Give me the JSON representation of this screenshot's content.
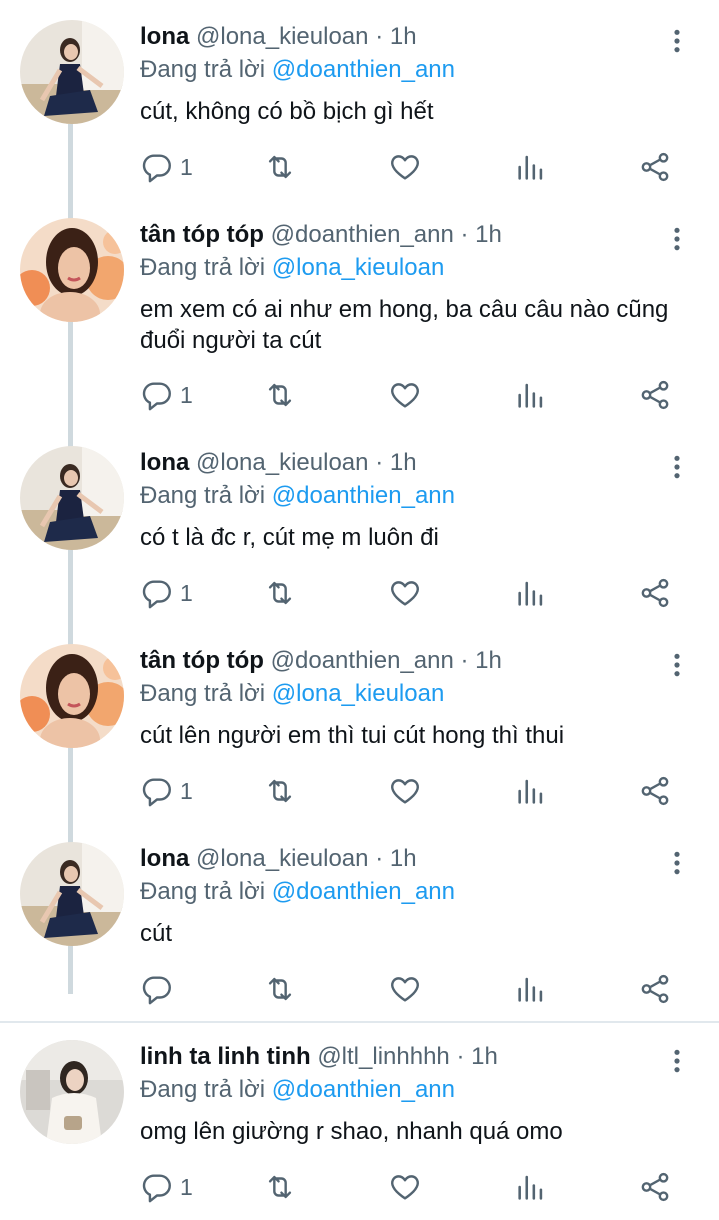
{
  "reply_prefix": "Đang trả lời",
  "tweets": [
    {
      "name": "lona",
      "handle": "@lona_kieuloan",
      "time": "· 1h",
      "reply_to": "@doanthien_ann",
      "text": "cút, không có bồ bịch gì hết",
      "reply_count": "1",
      "avatar": "lona-avatar"
    },
    {
      "name": "tân tóp tóp",
      "handle": "@doanthien_ann",
      "time": "· 1h",
      "reply_to": "@lona_kieuloan",
      "text": "em xem có ai như em hong, ba câu câu nào cũng đuổi người ta cút",
      "reply_count": "1",
      "avatar": "tan-avatar"
    },
    {
      "name": "lona",
      "handle": "@lona_kieuloan",
      "time": "· 1h",
      "reply_to": "@doanthien_ann",
      "text": "có t là đc r, cút mẹ m luôn đi",
      "reply_count": "1",
      "avatar": "lona-avatar"
    },
    {
      "name": "tân tóp tóp",
      "handle": "@doanthien_ann",
      "time": "· 1h",
      "reply_to": "@lona_kieuloan",
      "text": "cút lên người em thì tui cút hong thì thui",
      "reply_count": "1",
      "avatar": "tan-avatar"
    },
    {
      "name": "lona",
      "handle": "@lona_kieuloan",
      "time": "· 1h",
      "reply_to": "@doanthien_ann",
      "text": "cút",
      "reply_count": "",
      "avatar": "lona-avatar"
    },
    {
      "name": "linh ta linh tinh",
      "handle": "@ltl_linhhhh",
      "time": "· 1h",
      "reply_to": "@doanthien_ann",
      "text": "omg lên giường r shao, nhanh quá omo",
      "reply_count": "1",
      "avatar": "linh-avatar"
    }
  ],
  "colors": {
    "accent": "#1d9bf0",
    "muted": "#536471",
    "thread_line": "#cfd9de"
  },
  "icons": [
    "reply-icon",
    "retweet-icon",
    "like-icon",
    "views-icon",
    "share-icon",
    "more-icon"
  ]
}
